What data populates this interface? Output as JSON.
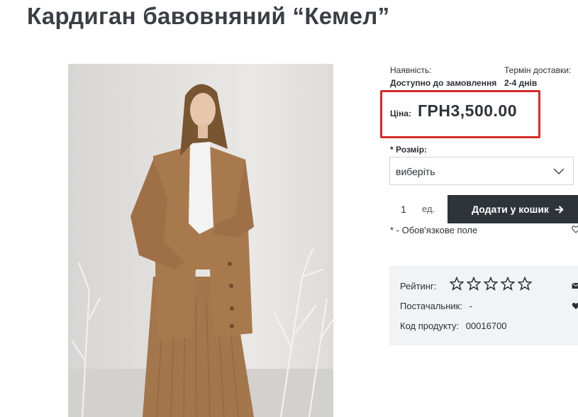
{
  "product": {
    "title": "Кардиган бавовняний “Кемел”",
    "image_icon": "product-photo"
  },
  "availability": {
    "label": "Наявність:",
    "value": "Доступно до замовлення"
  },
  "delivery": {
    "label": "Термін доставки:",
    "value": "2-4 днів"
  },
  "price": {
    "label": "Ціна:",
    "value": "ГРН3,500.00",
    "highlight_color": "#d62b2b"
  },
  "size": {
    "label": "* Розмір:",
    "selected": "виберіть"
  },
  "quantity": {
    "value": "1",
    "unit": "ед."
  },
  "cart": {
    "button_label": "Додати у кошик",
    "button_color": "#2f343a"
  },
  "required_note": "* - Обов'язкове поле",
  "info": {
    "rating_label": "Рейтинг:",
    "rating_value": 0,
    "rating_max": 5,
    "supplier_label": "Постачальник:",
    "supplier_value": "-",
    "code_label": "Код продукту:",
    "code_value": "00016700"
  }
}
